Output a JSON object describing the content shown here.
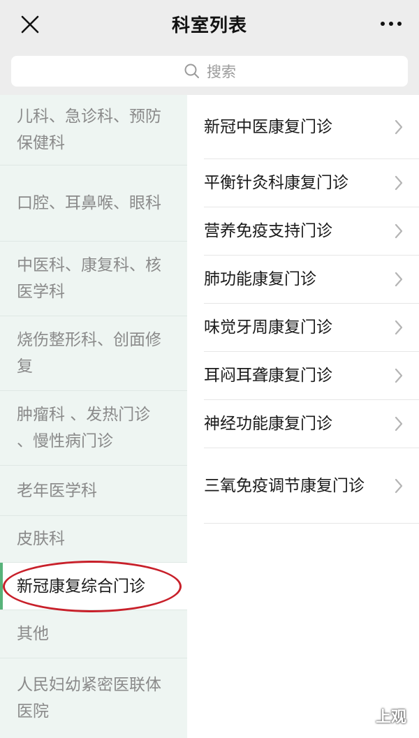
{
  "navbar": {
    "title": "科室列表",
    "close_icon": "close-icon",
    "more_icon": "more-dots-icon"
  },
  "search": {
    "placeholder": "搜索",
    "icon": "search-icon"
  },
  "sidebar": {
    "items": [
      {
        "label": "儿科、急诊科、预防保健科"
      },
      {
        "label": "口腔、耳鼻喉、眼科"
      },
      {
        "label": "中医科、康复科、核医学科"
      },
      {
        "label": "烧伤整形科、创面修复"
      },
      {
        "label": "肿瘤科 、发热门诊 、慢性病门诊"
      },
      {
        "label": "老年医学科"
      },
      {
        "label": "皮肤科"
      },
      {
        "label": "新冠康复综合门诊",
        "selected": true
      },
      {
        "label": "其他"
      },
      {
        "label": "人民妇幼紧密医联体医院"
      }
    ]
  },
  "clinics": {
    "items": [
      {
        "label": "新冠中医康复门诊"
      },
      {
        "label": "平衡针灸科康复门诊"
      },
      {
        "label": "营养免疫支持门诊"
      },
      {
        "label": "肺功能康复门诊"
      },
      {
        "label": "味觉牙周康复门诊"
      },
      {
        "label": "耳闷耳聋康复门诊"
      },
      {
        "label": "神经功能康复门诊"
      },
      {
        "label": "三氧免疫调节康复门诊"
      }
    ]
  },
  "watermark": {
    "text": "上观"
  },
  "colors": {
    "accent": "#58b37a",
    "sidebar_bg": "#eef5f2",
    "highlight_ellipse": "#c8202a"
  }
}
